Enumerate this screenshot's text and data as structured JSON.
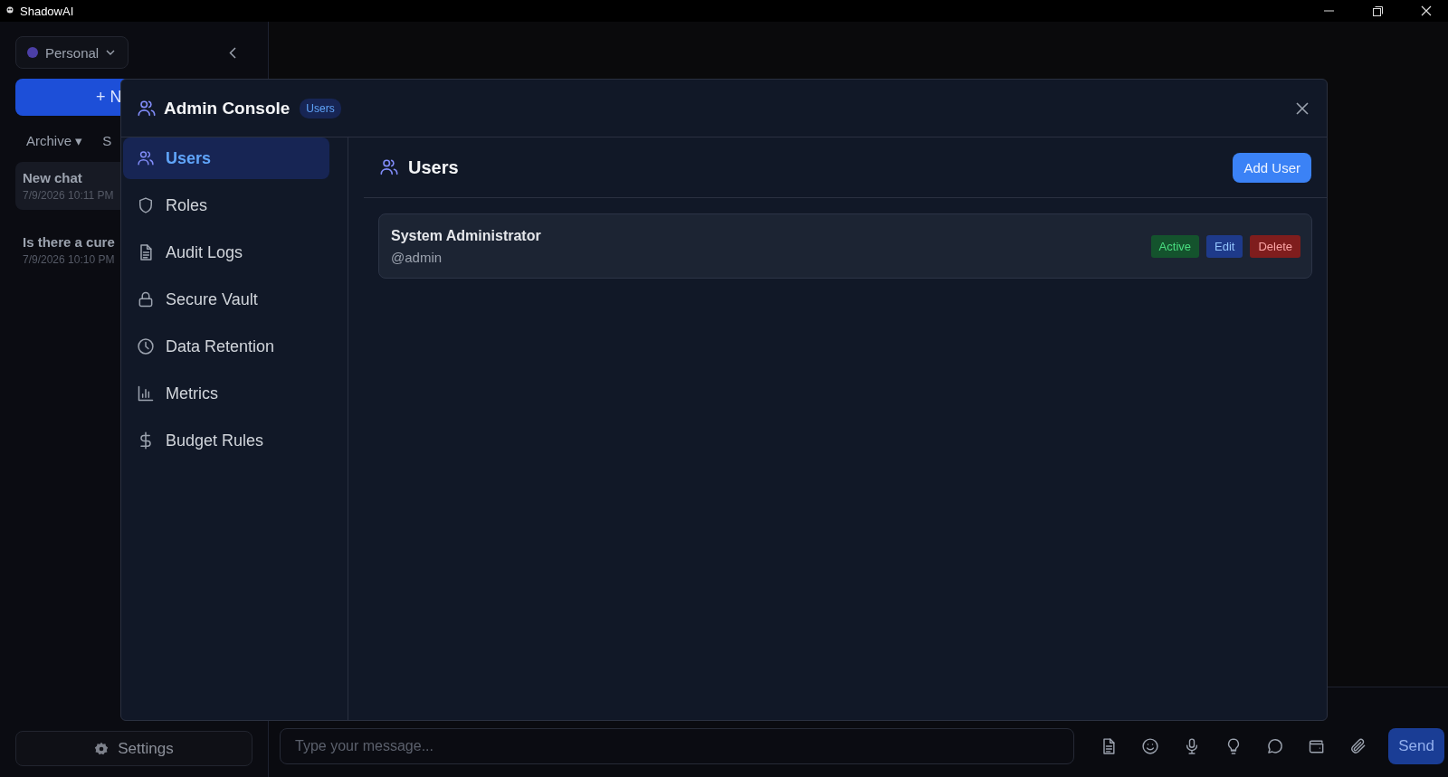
{
  "window": {
    "title": "ShadowAI"
  },
  "sidebar": {
    "workspace": "Personal",
    "new_chat": "+ N",
    "filters": [
      "Archive ▾",
      "S"
    ],
    "chats": [
      {
        "title": "New chat",
        "time": "7/9/2026 10:11 PM",
        "selected": true
      },
      {
        "title": "Is there a cure",
        "time": "7/9/2026 10:10 PM",
        "selected": false
      }
    ],
    "settings": "Settings"
  },
  "modal": {
    "title": "Admin Console",
    "badge": "Users",
    "nav": [
      {
        "label": "Users",
        "selected": true
      },
      {
        "label": "Roles",
        "selected": false
      },
      {
        "label": "Audit Logs",
        "selected": false
      },
      {
        "label": "Secure Vault",
        "selected": false
      },
      {
        "label": "Data Retention",
        "selected": false
      },
      {
        "label": "Metrics",
        "selected": false
      },
      {
        "label": "Budget Rules",
        "selected": false
      }
    ],
    "section_title": "Users",
    "add_button": "Add User",
    "users": [
      {
        "name": "System Administrator",
        "handle": "@admin",
        "tags": [
          {
            "kind": "status",
            "label": "Active"
          },
          {
            "kind": "edit",
            "label": "Edit"
          },
          {
            "kind": "delete",
            "label": "Delete"
          }
        ]
      }
    ]
  },
  "composer": {
    "placeholder": "Type your message...",
    "send": "Send"
  }
}
